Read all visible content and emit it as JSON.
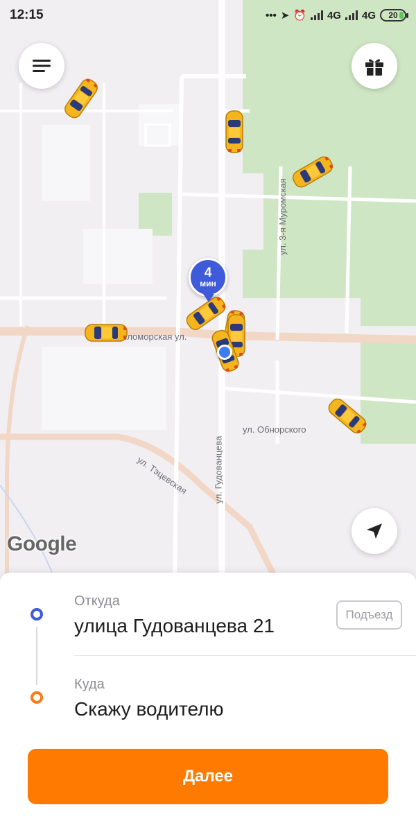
{
  "status_bar": {
    "time": "12:15",
    "network_1": "4G",
    "network_2": "4G",
    "battery": "20",
    "icons": [
      "more-dots-icon",
      "location-arrow-icon",
      "alarm-icon",
      "signal-icon",
      "signal-icon",
      "battery-icon"
    ]
  },
  "map": {
    "streets": {
      "belomorskaya": "Беломорская ул.",
      "muromskaya": "ул. 3-я Муромская",
      "obnorskogo": "ул. Обнорского",
      "gudovantseva": "ул. Гудованцева",
      "tetsevskaya": "ул. Тэцевская"
    },
    "pin": {
      "number": "4",
      "unit": "мин"
    },
    "google_logo": "Google",
    "car_count": 9
  },
  "buttons": {
    "menu_icon": "menu-icon",
    "gift_icon": "gift-icon",
    "locate_icon": "navigation-arrow-icon"
  },
  "route": {
    "from_label": "Откуда",
    "from_value": "улица Гудованцева 21",
    "entrance_button": "Подъезд",
    "to_label": "Куда",
    "to_value": "Скажу водителю"
  },
  "actions": {
    "next_label": "Далее"
  },
  "colors": {
    "accent": "#ff7a00",
    "pin_blue": "#3f5bd9",
    "from_dot": "#3f5bd9",
    "to_dot": "#ff7a12",
    "park_green": "#cfe6c4"
  }
}
